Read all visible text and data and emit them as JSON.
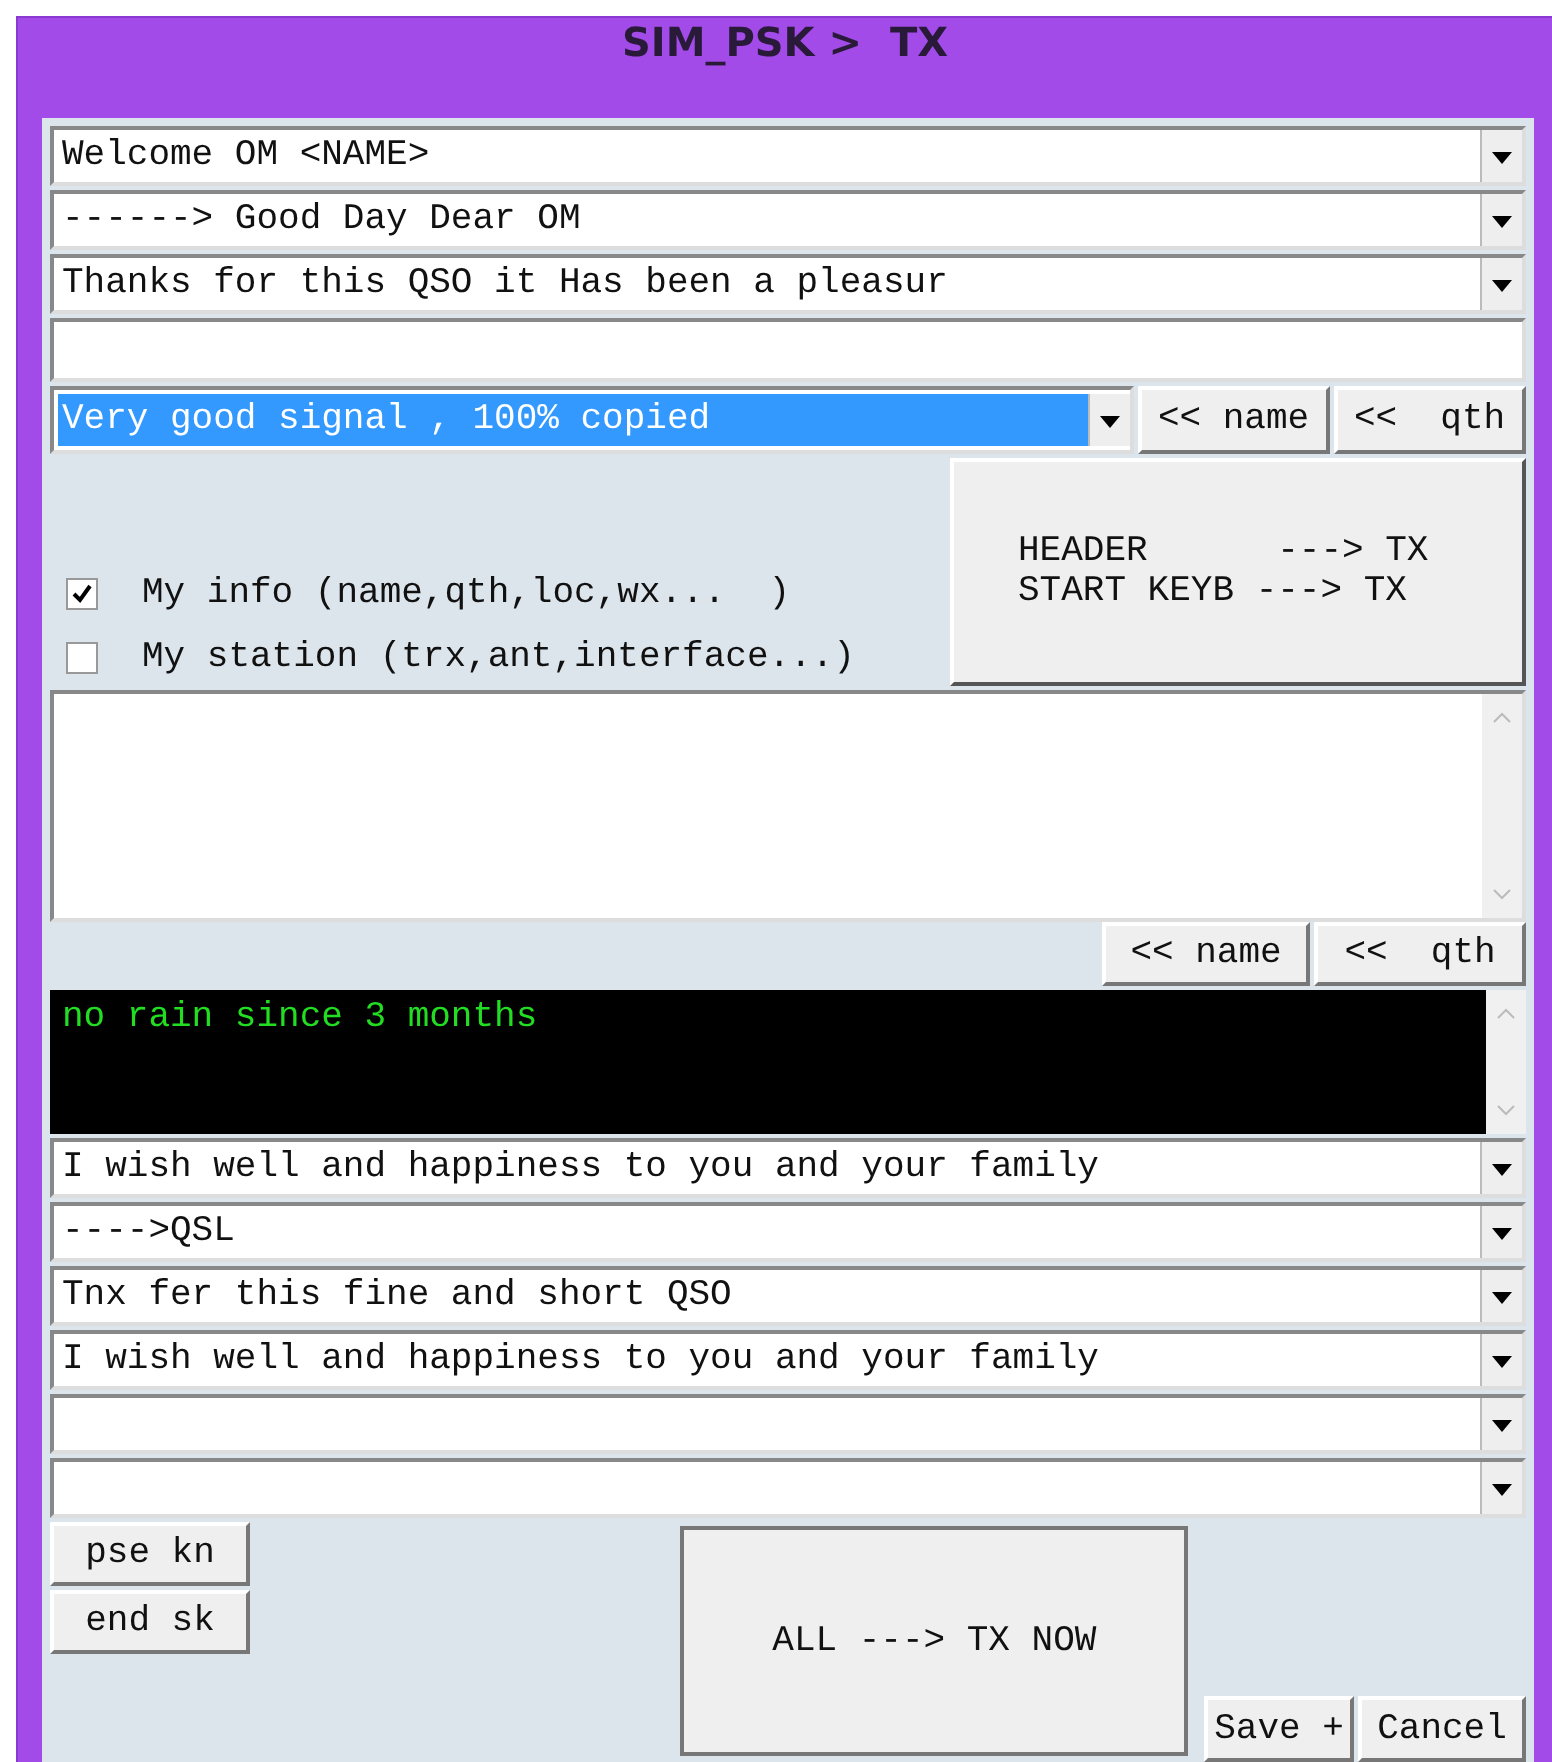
{
  "window": {
    "title": "SIM_PSK >  TX"
  },
  "top_combos": [
    {
      "value": "Welcome OM <NAME>"
    },
    {
      "value": "------> Good Day Dear OM"
    },
    {
      "value": "Thanks for this QSO it Has been a pleasur"
    }
  ],
  "signal_combo": {
    "value": "Very good signal , 100% copied"
  },
  "insert_buttons_top": [
    "<< name",
    "<<  qth"
  ],
  "checkboxes": [
    {
      "label": "My info (name,qth,loc,wx...  )",
      "checked": true
    },
    {
      "label": "My station (trx,ant,interface...)",
      "checked": false
    }
  ],
  "header_button": {
    "lines": [
      "HEADER      ---> TX",
      "START KEYB ---> TX"
    ]
  },
  "insert_buttons_bottom": [
    "<< name",
    "<<  qth"
  ],
  "console": {
    "text": "no rain since 3 months"
  },
  "bottom_combos": [
    {
      "kind": "text",
      "value": "I wish well and happiness to you and your family"
    },
    {
      "kind": "text",
      "value": "---->QSL"
    },
    {
      "kind": "text",
      "value": "Tnx fer this fine and short QSO"
    },
    {
      "kind": "text",
      "value": "I wish well and happiness to you and your family"
    },
    {
      "kind": "empty"
    },
    {
      "kind": "empty"
    }
  ],
  "side_buttons": [
    "pse kn",
    "end sk"
  ],
  "send_button": "ALL ---> TX NOW",
  "dialog_buttons": [
    "Save +",
    "Cancel"
  ]
}
